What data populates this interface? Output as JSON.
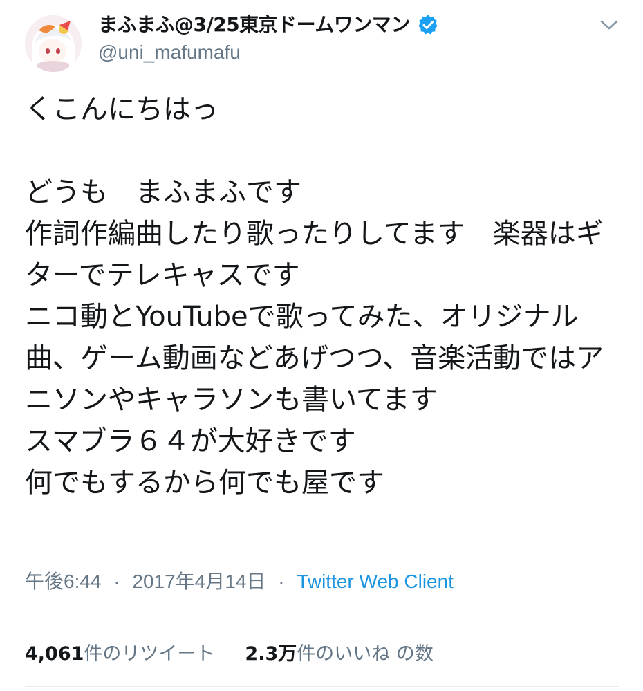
{
  "user": {
    "display_name": "まふまふ@3/25東京ドームワンマン",
    "handle": "@uni_mafumafu",
    "verified": true
  },
  "tweet": {
    "text": "くこんにちはっ\n\nどうも　まふまふです\n作詞作編曲したり歌ったりしてます　楽器はギターでテレキャスです\nニコ動とYouTubeで歌ってみた、オリジナル曲、ゲーム動画などあげつつ、音楽活動ではアニソンやキャラソンも書いてます\nスマブラ６４が大好きです\n何でもするから何でも屋です",
    "time": "午後6:44",
    "separator": "·",
    "date": "2017年4月14日",
    "client": "Twitter Web Client"
  },
  "stats": {
    "retweets_count": "4,061",
    "retweets_label": "件のリツイート",
    "likes_count": "2.3万",
    "likes_label": "件のいいね の数"
  },
  "icons": {
    "verified": "verified-badge-icon",
    "caret": "chevron-down-icon",
    "avatar": "avatar-image"
  },
  "colors": {
    "text": "#14171a",
    "secondary": "#657786",
    "link": "#1b95e0",
    "verified": "#1da1f2",
    "divider": "#e6ecf0"
  }
}
